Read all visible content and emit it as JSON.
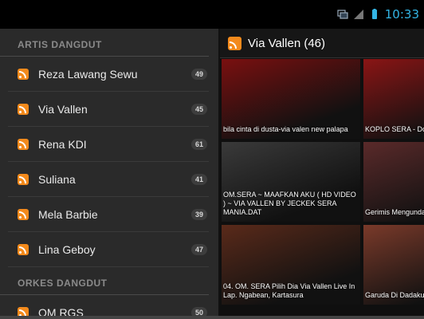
{
  "status": {
    "time": "10:33"
  },
  "sidebar": {
    "sections": [
      {
        "header": "ARTIS DANGDUT",
        "items": [
          {
            "label": "Reza Lawang Sewu",
            "count": "49"
          },
          {
            "label": "Via Vallen",
            "count": "45"
          },
          {
            "label": "Rena KDI",
            "count": "61"
          },
          {
            "label": "Suliana",
            "count": "41"
          },
          {
            "label": "Mela Barbie",
            "count": "39"
          },
          {
            "label": "Lina Geboy",
            "count": "47"
          }
        ]
      },
      {
        "header": "ORKES DANGDUT",
        "items": [
          {
            "label": "OM RGS",
            "count": "50"
          }
        ]
      }
    ]
  },
  "main": {
    "title": "Via Vallen (46)",
    "videos": [
      {
        "caption": "bila cinta di dusta-via valen new palapa",
        "color": "#7a1010"
      },
      {
        "caption": "KOPLO SERA - Doko Via vallen.flv",
        "color": "#8a1515"
      },
      {
        "caption": "OM.SERA ~ MAAFKAN AKU ( HD VIDEO ) ~ VIA VALLEN BY JECKEK SERA MANIA.DAT",
        "color": "#3a3a3a"
      },
      {
        "caption": "Gerimis Mengunda",
        "color": "#5a2a2a"
      },
      {
        "caption": "04. OM. SERA Pilih Dia Via Vallen Live In Lap. Ngabean, Kartasura",
        "color": "#5a2a1a"
      },
      {
        "caption": "Garuda Di Dadaku, \"Seraaaa live JTV\"",
        "color": "#7a3a2a"
      }
    ]
  }
}
